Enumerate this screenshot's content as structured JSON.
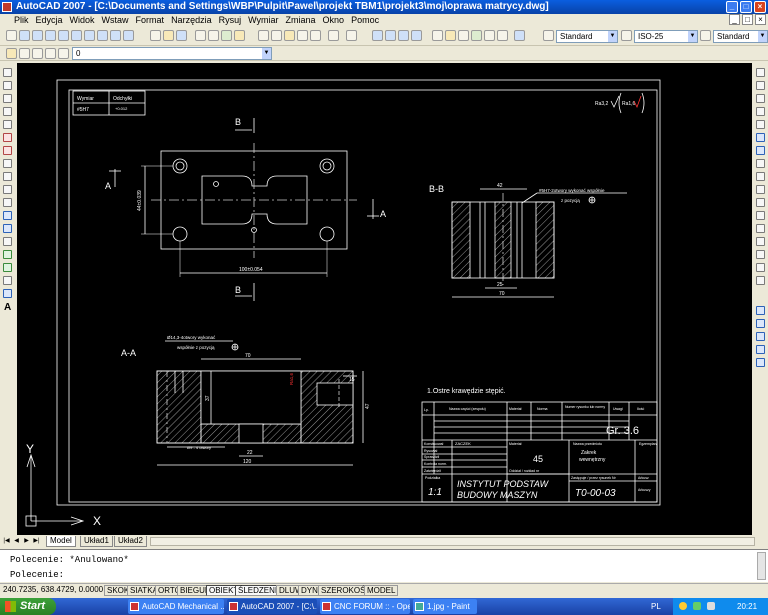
{
  "window": {
    "title": "AutoCAD 2007 - [C:\\Documents and Settings\\WBP\\Pulpit\\Pawel\\projekt TBM1\\projekt3\\moj\\oprawa matrycy.dwg]",
    "minimize": "_",
    "maximize": "□",
    "close": "×"
  },
  "menu": [
    "Plik",
    "Edycja",
    "Widok",
    "Wstaw",
    "Format",
    "Narzędzia",
    "Rysuj",
    "Wymiar",
    "Zmiana",
    "Okno",
    "Pomoc"
  ],
  "toolbar": {
    "text_style": "Standard",
    "dim_style": "ISO-25",
    "table_style": "Standard",
    "layer": "0"
  },
  "drawing": {
    "table_header_left": "Wymiar",
    "table_header_right": "Odchyłki",
    "table_row_left": "#5H7",
    "table_row_right": "+0.012",
    "roughness_1": "Ra3,2",
    "roughness_2": "Ra1,6",
    "section_b_top": "B",
    "section_b_bottom": "B",
    "section_a_left": "A",
    "section_a_right": "A",
    "dim_height": "44±0.039",
    "dim_width": "100±0.054",
    "section_bb_title": "B-B",
    "dim_42": "42",
    "dim_25": "25",
    "dim_70_bb": "70",
    "note_bb_1": "#5H7-2otwory wykonać współnie",
    "note_bb_2": "z pozycją",
    "section_aa_title": "A-A",
    "note_aa_1": "Ø14,3-4otwory wykonać",
    "note_aa_2": "współnie z pozycją",
    "dim_70_aa": "70",
    "dim_37": "37",
    "dim_15": "15",
    "dim_47": "47",
    "dim_4holes": "Ø9 - 4 otwory",
    "dim_22": "22",
    "dim_120": "120",
    "dim_ra_aa": "Ra1,6",
    "general_note": "1.Ostre krawędzie stępić.",
    "tb_lp": "Lp.",
    "tb_nazwa": "Nazwa części (zespołu)",
    "tb_material_col": "Materiał",
    "tb_norma": "Norma",
    "tb_numer_rys": "Numer rysunku lub normy",
    "tb_uwagi": "Uwagi",
    "tb_ilosc": "Ilość",
    "tb_group": "Gr. 3.6",
    "tb_konstruowal": "Konstruował",
    "tb_rysowal": "Rysował",
    "tb_sprawdzil": "Sprawdził",
    "tb_kontrola": "Kontrola norm.",
    "tb_zatwierdzil": "Zatwierdził",
    "tb_author": "ZACZEK",
    "tb_material": "Materiał",
    "tb_material_val": "45",
    "tb_nazwa_przedm": "Nazwa przedmiotu",
    "tb_name_val_1": "Zakrek",
    "tb_name_val_2": "wewnętrzny",
    "tb_egzemplarz": "Egzemplarz",
    "tb_podzialka": "Podziałka",
    "tb_scale": "1:1",
    "tb_institute_1": "INSTYTUT PODSTAW",
    "tb_institute_2": "BUDOWY MASZYN",
    "tb_oddzial": "Oddział / rozkład nr",
    "tb_zastapiono": "Zastępuje / przez rysunek Nr",
    "tb_arkusz": "Arkusz",
    "tb_arkuszy": "Arkuszy",
    "tb_drawing_no": "T0-00-03",
    "ucs_x": "X",
    "ucs_y": "Y"
  },
  "tabs": {
    "model": "Model",
    "layout1": "Układ1",
    "layout2": "Układ2"
  },
  "command": {
    "line1": "Polecenie: *Anulowano*",
    "line2": "Polecenie:"
  },
  "status": {
    "coords": "240.7235, 638.4729, 0.0000",
    "buttons": [
      "SKOK",
      "SIATKA",
      "ORTO",
      "BIEGUN",
      "OBIEKT",
      "ŚLEDZENIE",
      "DLUW",
      "DYN",
      "SZEROKOŚĆ",
      "MODEL"
    ]
  },
  "taskbar": {
    "start": "Start",
    "tasks": [
      "AutoCAD Mechanical ...",
      "AutoCAD 2007 - [C:\\...",
      "CNC FORUM :: - Opera",
      "1.jpg - Paint"
    ],
    "lang": "PL",
    "clock": "20:21"
  }
}
